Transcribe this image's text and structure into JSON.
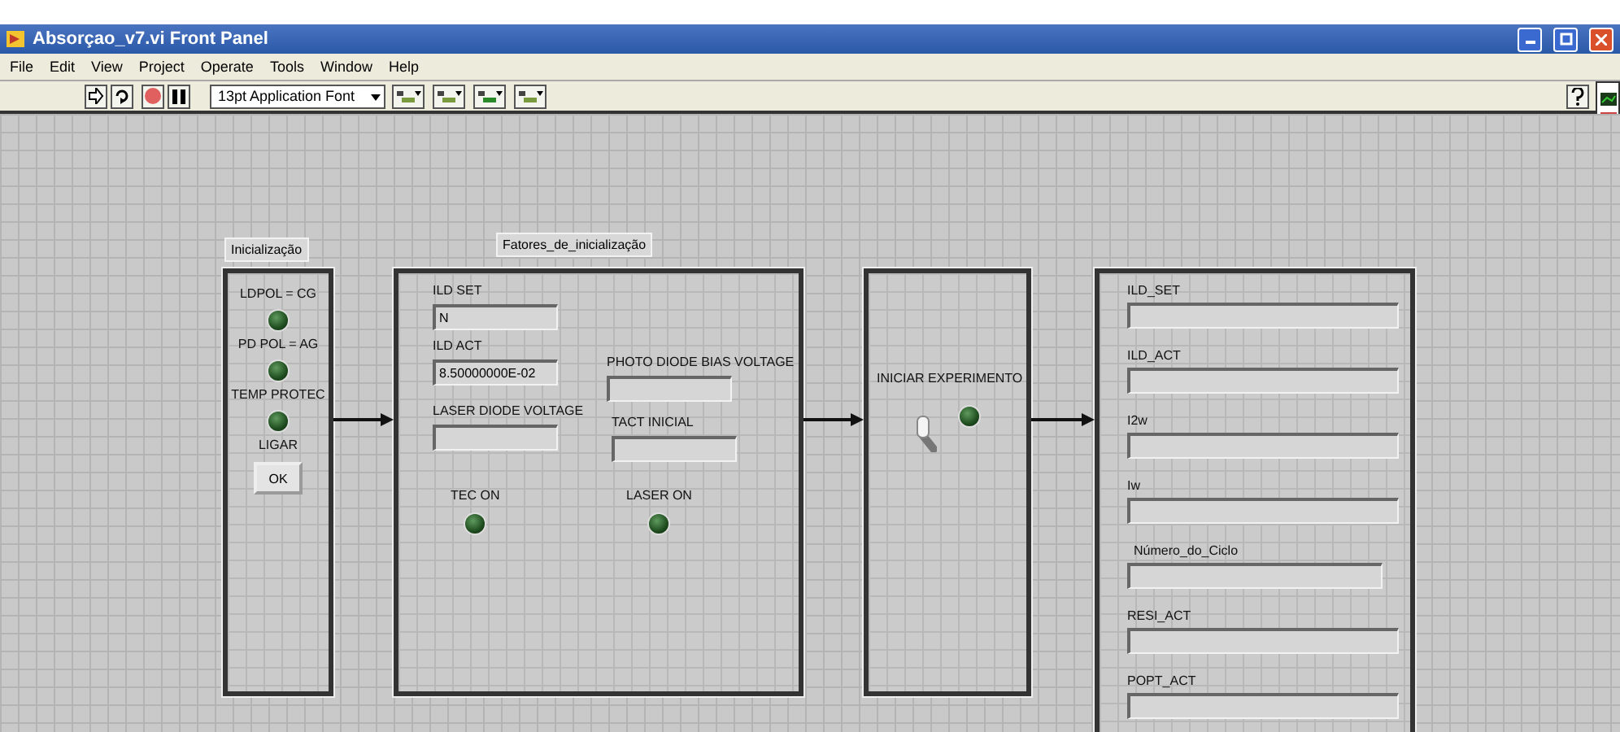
{
  "window": {
    "title": "Absorçao_v7.vi Front Panel"
  },
  "menu": [
    "File",
    "Edit",
    "View",
    "Project",
    "Operate",
    "Tools",
    "Window",
    "Help"
  ],
  "toolbar": {
    "font": "13pt Application Font"
  },
  "frames": [
    {
      "label": "Inicialização",
      "controls": [
        {
          "kind": "led",
          "label": "LDPOL = CG",
          "on": false
        },
        {
          "kind": "led",
          "label": "PD POL = AG",
          "on": false
        },
        {
          "kind": "led",
          "label": "TEMP PROTEC",
          "on": false
        },
        {
          "kind": "button",
          "label": "LIGAR",
          "text": "OK"
        }
      ]
    },
    {
      "label": "Fatores_de_inicialização",
      "controls": [
        {
          "kind": "field",
          "label": "ILD SET",
          "value": "N"
        },
        {
          "kind": "field",
          "label": "ILD ACT",
          "value": "8.50000000E-02"
        },
        {
          "kind": "field",
          "label": "LASER DIODE VOLTAGE"
        },
        {
          "kind": "field",
          "label": "PHOTO DIODE BIAS VOLTAGE"
        },
        {
          "kind": "field",
          "label": "TACT INICIAL"
        },
        {
          "kind": "led",
          "label": "TEC ON",
          "on": false
        },
        {
          "kind": "led",
          "label": "LASER ON",
          "on": false
        }
      ]
    },
    {
      "controls": [
        {
          "kind": "text",
          "label": "INICIAR EXPERIMENTO"
        },
        {
          "kind": "toggle",
          "on": false
        },
        {
          "kind": "led",
          "on": false
        }
      ]
    },
    {
      "controls": [
        {
          "kind": "field",
          "label": "ILD_SET"
        },
        {
          "kind": "field",
          "label": "ILD_ACT"
        },
        {
          "kind": "field",
          "label": "I2w"
        },
        {
          "kind": "field",
          "label": "Iw"
        },
        {
          "kind": "field",
          "label": "Número_do_Ciclo"
        },
        {
          "kind": "field",
          "label": "RESI_ACT"
        },
        {
          "kind": "field",
          "label": "POPT_ACT"
        }
      ]
    }
  ]
}
